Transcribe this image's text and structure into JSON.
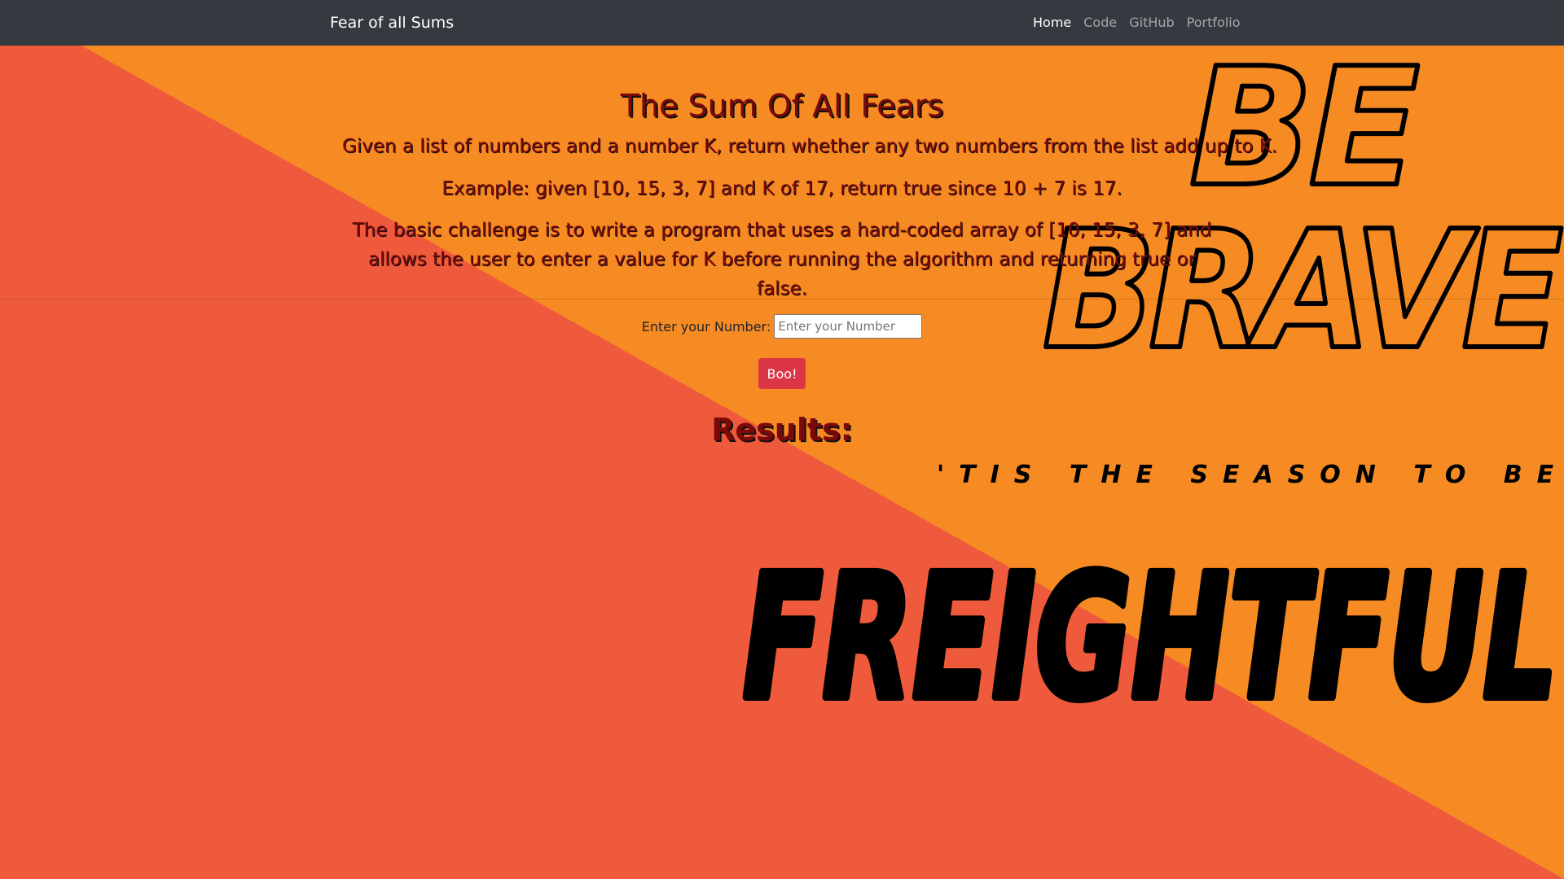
{
  "nav": {
    "brand": "Fear of all Sums",
    "links": [
      "Home",
      "Code",
      "GitHub",
      "Portfolio"
    ]
  },
  "main": {
    "title": "The Sum Of All Fears",
    "paragraph1": "Given a list of numbers and a number K, return whether any two numbers from the list add up to K.",
    "paragraph2": "Example: given [10, 15, 3, 7] and K of 17, return true since 10 + 7 is 17.",
    "paragraph3": "The basic challenge is to write a program that uses a hard-coded array of [10, 15, 3, 7] and allows the user to enter a value for K before running the algorithm and returning true or false."
  },
  "form": {
    "label": "Enter your Number:",
    "input_value": "",
    "input_placeholder": "Enter your Number",
    "button_label": "Boo!"
  },
  "results": {
    "heading": "Results:"
  },
  "graphic": {
    "line1": "BE",
    "line2": "BRAVE",
    "tagline": "'TIS THE SEASON TO BE",
    "headline": "FREIGHTFUL"
  },
  "colors": {
    "navbar": "#343a40",
    "orange": "#f68a23",
    "coral": "#ef5a3c",
    "button": "#dc3545",
    "title_text": "#7a0a0a"
  }
}
